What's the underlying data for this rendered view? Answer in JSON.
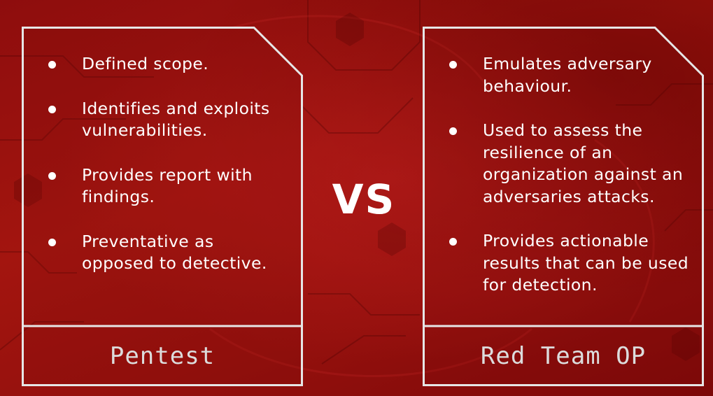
{
  "theme": {
    "background": "#9a120f",
    "frame_color": "#e6e6e6",
    "text_color": "#ffffff"
  },
  "left_card": {
    "bullets": [
      "Defined scope.",
      "Identifies and exploits vulnerabilities.",
      "Provides report with findings.",
      "Preventative as opposed to detective."
    ],
    "title": "Pentest"
  },
  "vs_label": "VS",
  "right_card": {
    "bullets": [
      "Emulates adversary behaviour.",
      "Used to assess the resilience of an organization against an adversaries attacks.",
      "Provides actionable results that can be used for detection."
    ],
    "title": "Red Team OP"
  }
}
